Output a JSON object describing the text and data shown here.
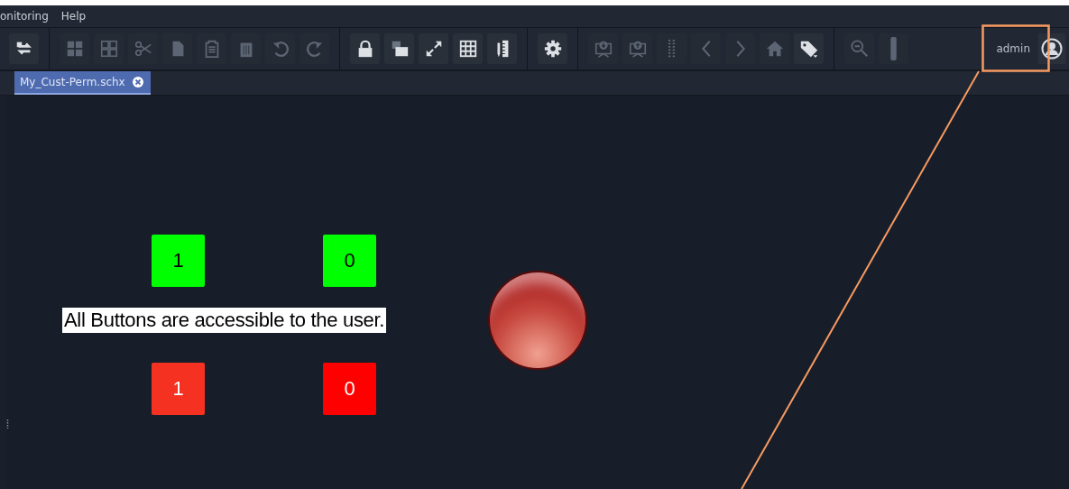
{
  "menu": [
    {
      "label": "onitoring"
    },
    {
      "label": "Help"
    }
  ],
  "toolbar": [
    {
      "kind": "swap",
      "disabled": false
    },
    {
      "kind": "separator"
    },
    {
      "kind": "tiles",
      "disabled": true
    },
    {
      "kind": "tiles-outline",
      "disabled": true
    },
    {
      "kind": "cut",
      "disabled": true
    },
    {
      "kind": "copy",
      "disabled": true
    },
    {
      "kind": "paste",
      "disabled": true
    },
    {
      "kind": "delete",
      "disabled": true
    },
    {
      "kind": "undo",
      "disabled": true
    },
    {
      "kind": "redo",
      "disabled": true
    },
    {
      "kind": "separator"
    },
    {
      "kind": "lock",
      "disabled": false
    },
    {
      "kind": "layers",
      "disabled": false
    },
    {
      "kind": "expand",
      "disabled": false
    },
    {
      "kind": "grid",
      "disabled": false
    },
    {
      "kind": "ruler",
      "disabled": false
    },
    {
      "kind": "separator"
    },
    {
      "kind": "settings",
      "disabled": false
    },
    {
      "kind": "separator"
    },
    {
      "kind": "download",
      "disabled": true
    },
    {
      "kind": "upload",
      "disabled": true
    },
    {
      "kind": "grip",
      "disabled": true
    },
    {
      "kind": "back",
      "disabled": true
    },
    {
      "kind": "forward",
      "disabled": true
    },
    {
      "kind": "home",
      "disabled": true
    },
    {
      "kind": "tag",
      "disabled": false
    },
    {
      "kind": "separator"
    },
    {
      "kind": "zoom-out",
      "disabled": true
    },
    {
      "kind": "slider",
      "disabled": true
    }
  ],
  "user": {
    "name": "admin"
  },
  "tabs": [
    {
      "label": "My_Cust-Perm.schx",
      "selected": true
    }
  ],
  "canvas": {
    "note": "All Buttons are accessible to the user.",
    "buttons": [
      {
        "label": "1",
        "color": "#00ff00"
      },
      {
        "label": "0",
        "color": "#00ff00"
      },
      {
        "label": "1",
        "color": "#f53222"
      },
      {
        "label": "0",
        "color": "#ff0000"
      }
    ],
    "lamp": {
      "on": false
    }
  }
}
